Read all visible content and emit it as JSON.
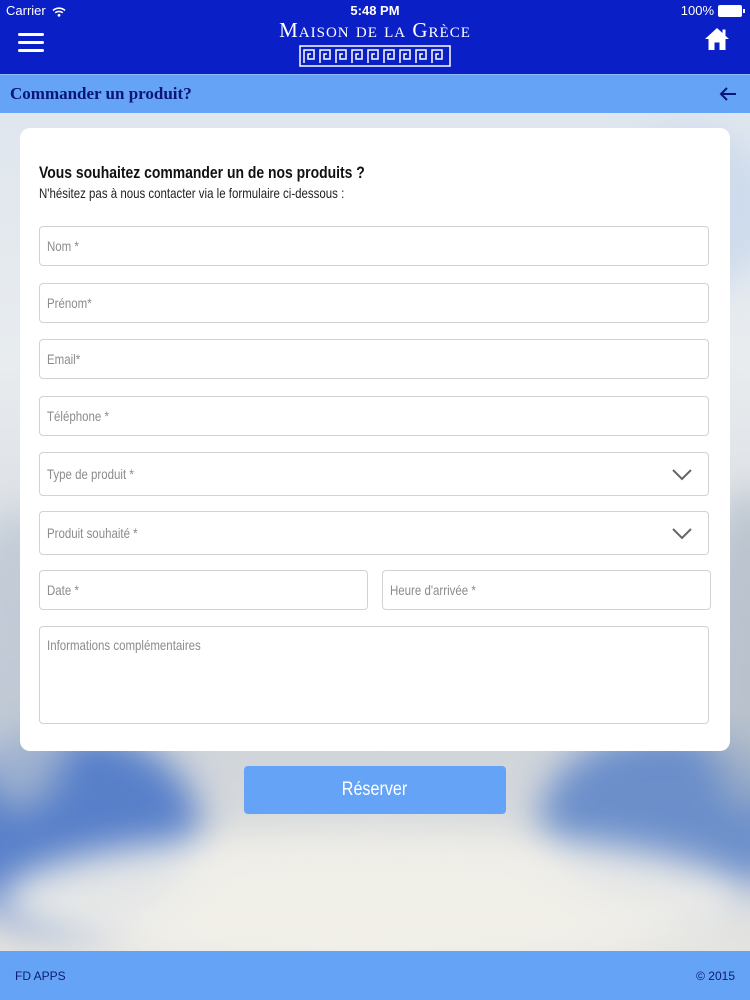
{
  "status_bar": {
    "carrier": "Carrier",
    "time": "5:48 PM",
    "battery": "100%"
  },
  "header": {
    "logo_text": "Maison de la Grèce",
    "menu_icon": "hamburger-icon",
    "home_icon": "home-icon"
  },
  "subheader": {
    "title": "Commander un produit?",
    "back_icon": "arrow-left-icon"
  },
  "form": {
    "heading": "Vous souhaitez commander un de nos produits ?",
    "subheading": "N'hésitez pas à nous contacter via le formulaire ci-dessous :",
    "fields": {
      "nom": "Nom *",
      "prenom": "Prénom*",
      "email": "Email*",
      "telephone": "Téléphone *",
      "type_produit": "Type de produit *",
      "produit_souhaite": "Produit souhaité *",
      "date": "Date *",
      "heure": "Heure d'arrivée *",
      "infos": "Informations complémentaires"
    },
    "submit_label": "Réserver"
  },
  "footer": {
    "left": "FD APPS",
    "right": "© 2015"
  },
  "colors": {
    "header_blue": "#0a1fc6",
    "accent_blue": "#64a3f6",
    "title_navy": "#0a1578"
  }
}
